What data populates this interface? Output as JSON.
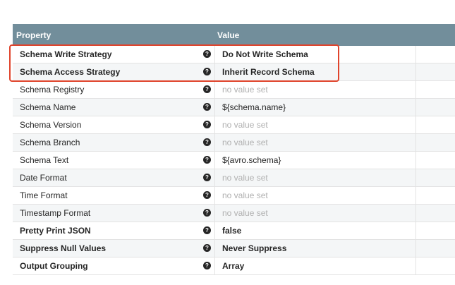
{
  "header": {
    "property_label": "Property",
    "value_label": "Value"
  },
  "rows": [
    {
      "name": "Schema Write Strategy",
      "value": "Do Not Write Schema",
      "bold": true,
      "set": true
    },
    {
      "name": "Schema Access Strategy",
      "value": "Inherit Record Schema",
      "bold": true,
      "set": true
    },
    {
      "name": "Schema Registry",
      "value": "no value set",
      "bold": false,
      "set": false
    },
    {
      "name": "Schema Name",
      "value": "${schema.name}",
      "bold": false,
      "set": true
    },
    {
      "name": "Schema Version",
      "value": "no value set",
      "bold": false,
      "set": false
    },
    {
      "name": "Schema Branch",
      "value": "no value set",
      "bold": false,
      "set": false
    },
    {
      "name": "Schema Text",
      "value": "${avro.schema}",
      "bold": false,
      "set": true
    },
    {
      "name": "Date Format",
      "value": "no value set",
      "bold": false,
      "set": false
    },
    {
      "name": "Time Format",
      "value": "no value set",
      "bold": false,
      "set": false
    },
    {
      "name": "Timestamp Format",
      "value": "no value set",
      "bold": false,
      "set": false
    },
    {
      "name": "Pretty Print JSON",
      "value": "false",
      "bold": true,
      "set": true
    },
    {
      "name": "Suppress Null Values",
      "value": "Never Suppress",
      "bold": true,
      "set": true
    },
    {
      "name": "Output Grouping",
      "value": "Array",
      "bold": true,
      "set": true
    }
  ],
  "help_glyph": "?",
  "icons": {
    "help": "question-circle-icon"
  },
  "colors": {
    "header_bg": "#728e9b",
    "highlight_border": "#e0442c"
  }
}
